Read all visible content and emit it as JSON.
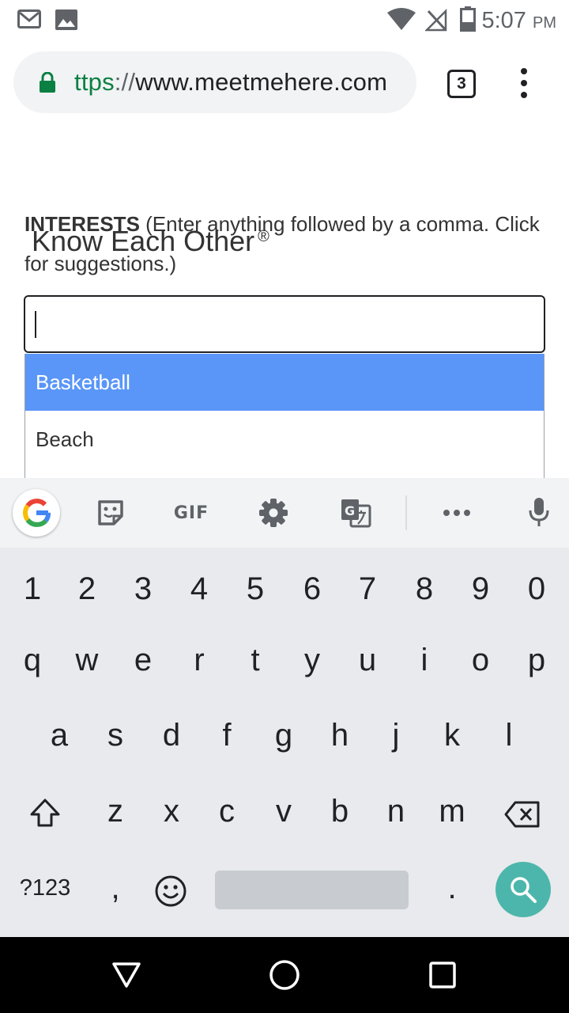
{
  "status_bar": {
    "time": "5:07",
    "ampm": "PM",
    "icons": [
      "gmail-icon",
      "image-icon",
      "wifi-icon",
      "no-signal-icon",
      "battery-icon"
    ]
  },
  "browser": {
    "url_scheme": "ttps",
    "url_sep": "://",
    "url_host": "www.meetmehere.com",
    "tab_count": "3",
    "icons": [
      "lock-icon",
      "menu-icon"
    ]
  },
  "page": {
    "interests_label": "INTERESTS",
    "interests_hint": " (Enter anything followed by a comma. Click for suggestions.)",
    "overlay_title": "Know Each Other",
    "overlay_mark": "®",
    "input_value": "",
    "suggestions": [
      {
        "label": "Basketball",
        "highlighted": true
      },
      {
        "label": "Beach",
        "highlighted": false
      }
    ],
    "colors": {
      "highlight": "#5a96f8"
    }
  },
  "keyboard": {
    "toolbar_gif": "GIF",
    "toolbar_icons": [
      "google-icon",
      "sticker-icon",
      "gif-icon",
      "settings-icon",
      "translate-icon",
      "more-icon",
      "mic-icon"
    ],
    "row_numbers": [
      "1",
      "2",
      "3",
      "4",
      "5",
      "6",
      "7",
      "8",
      "9",
      "0"
    ],
    "row_1": [
      "q",
      "w",
      "e",
      "r",
      "t",
      "y",
      "u",
      "i",
      "o",
      "p"
    ],
    "row_2": [
      "a",
      "s",
      "d",
      "f",
      "g",
      "h",
      "j",
      "k",
      "l"
    ],
    "row_3": [
      "z",
      "x",
      "c",
      "v",
      "b",
      "n",
      "m"
    ],
    "symbols_label": "?123",
    "comma": ",",
    "period": ".",
    "colors": {
      "search": "#4db6ac",
      "background": "#e8eaed"
    }
  },
  "navbar": {
    "icons": [
      "back-icon",
      "home-icon",
      "recents-icon"
    ]
  }
}
